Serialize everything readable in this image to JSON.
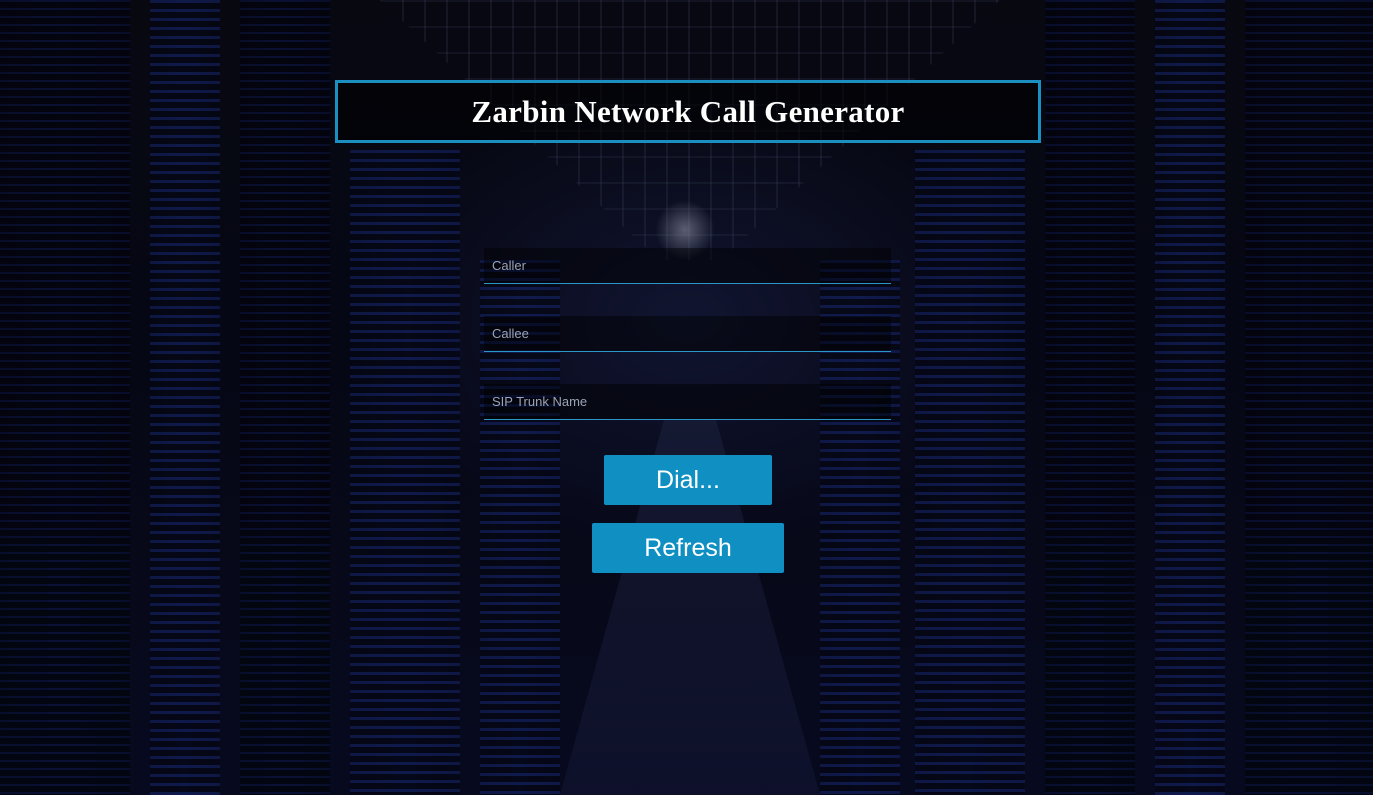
{
  "header": {
    "title": "Zarbin Network Call Generator"
  },
  "form": {
    "caller_placeholder": "Caller",
    "callee_placeholder": "Callee",
    "trunk_placeholder": "SIP Trunk Name",
    "caller_value": "",
    "callee_value": "",
    "trunk_value": ""
  },
  "actions": {
    "dial_label": "Dial...",
    "refresh_label": "Refresh"
  },
  "theme": {
    "accent": "#0f8fc2",
    "border_accent": "#1b8fbf",
    "background": "#0a0c20"
  }
}
